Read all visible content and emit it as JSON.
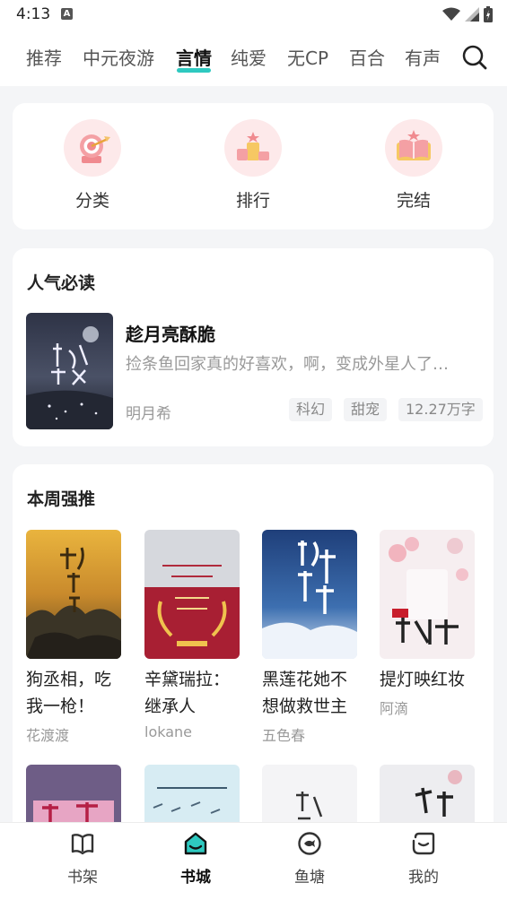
{
  "status": {
    "time": "4:13",
    "notification_glyph": "A"
  },
  "nav": {
    "tabs": [
      {
        "label": "推荐"
      },
      {
        "label": "中元夜游"
      },
      {
        "label": "言情"
      },
      {
        "label": "纯爱"
      },
      {
        "label": "无CP"
      },
      {
        "label": "百合"
      },
      {
        "label": "有声"
      }
    ],
    "active_tab": "言情",
    "accent_color": "#2ec9c0"
  },
  "categories": [
    {
      "label": "分类",
      "icon": "target-icon"
    },
    {
      "label": "排行",
      "icon": "podium-icon"
    },
    {
      "label": "完结",
      "icon": "book-star-icon"
    }
  ],
  "hot": {
    "title": "人气必读",
    "book": {
      "title": "趁月亮酥脆",
      "intro": "捡条鱼回家真的好喜欢，啊，变成外星人了…",
      "author": "明月希",
      "tags": [
        "科幻",
        "甜宠",
        "12.27万字"
      ]
    }
  },
  "weekly": {
    "title": "本周强推",
    "books": [
      {
        "title": "狗丞相，吃我一枪！",
        "author": "花渡渡"
      },
      {
        "title": "辛黛瑞拉：继承人",
        "author": "lokane"
      },
      {
        "title": "黑莲花她不想做救世主",
        "author": "五色春"
      },
      {
        "title": "提灯映红妆",
        "author": "阿滴"
      }
    ]
  },
  "bottom_nav": {
    "items": [
      {
        "label": "书架",
        "icon": "bookshelf-icon"
      },
      {
        "label": "书城",
        "icon": "bookstore-icon"
      },
      {
        "label": "鱼塘",
        "icon": "fishpond-icon"
      },
      {
        "label": "我的",
        "icon": "profile-icon"
      }
    ],
    "active": "书城"
  }
}
